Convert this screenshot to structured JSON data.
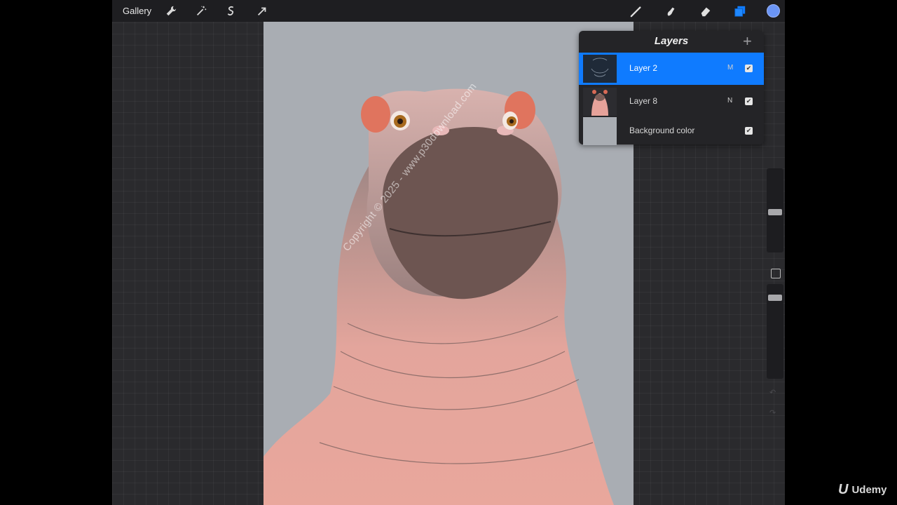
{
  "topbar": {
    "gallery_label": "Gallery",
    "left_tools": [
      "wrench-icon",
      "magic-wand-icon",
      "selection-icon",
      "transform-arrow-icon"
    ],
    "right_tools": [
      "brush-icon",
      "smudge-icon",
      "eraser-icon",
      "layers-icon"
    ],
    "active_color": "#6b95f5"
  },
  "layers_panel": {
    "title": "Layers",
    "add_label": "+",
    "rows": [
      {
        "name": "Layer 2",
        "mode": "M",
        "visible": true,
        "active": true
      },
      {
        "name": "Layer 8",
        "mode": "N",
        "visible": true,
        "active": false
      },
      {
        "name": "Background color",
        "mode": "",
        "visible": true,
        "active": false
      }
    ]
  },
  "canvas": {
    "watermark": "Copyright © 2025 - www.p30download.com",
    "background_color": "#a9adb3"
  },
  "side_controls": {
    "brush_size_level": 0.55,
    "opacity_level": 0.92,
    "undo_icon": "undo-icon",
    "redo_icon": "redo-icon"
  },
  "branding": {
    "logo_letter": "U",
    "name": "Udemy"
  },
  "colors": {
    "accent": "#0f7bff",
    "panel": "#242427",
    "topbar": "#1e1e21"
  }
}
